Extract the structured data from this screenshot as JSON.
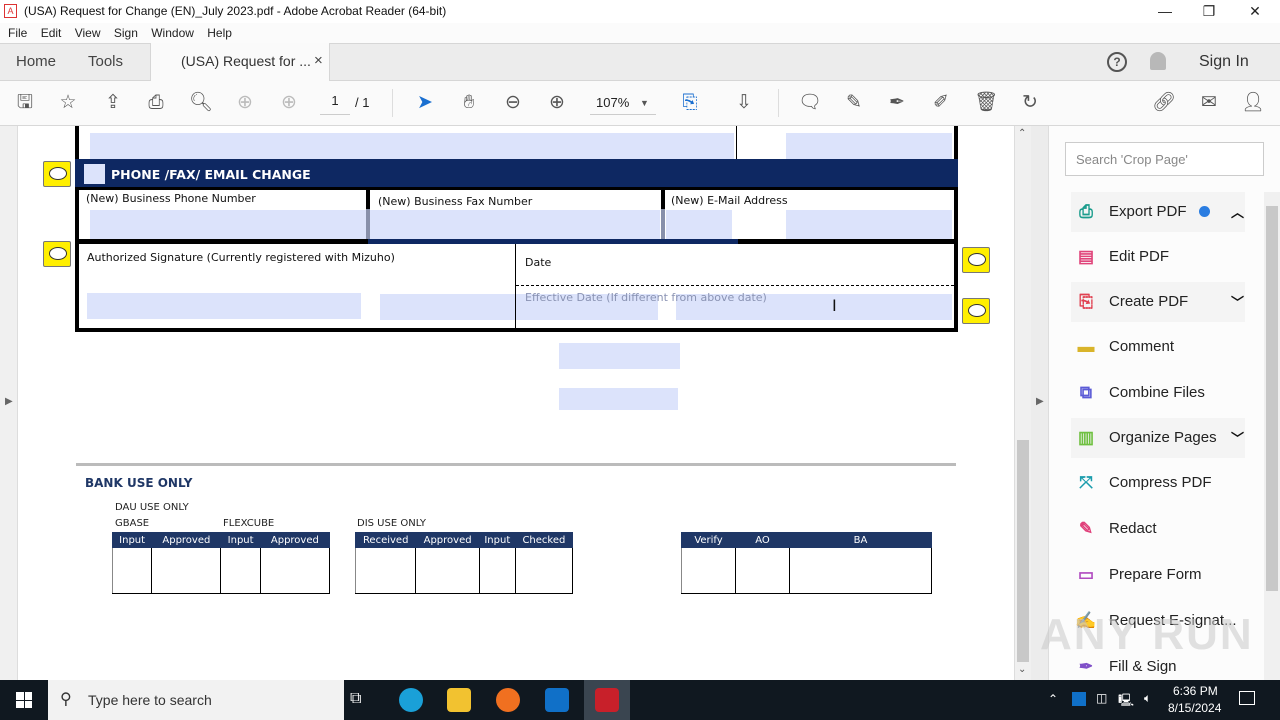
{
  "window": {
    "title": "(USA) Request for Change (EN)_July 2023.pdf - Adobe Acrobat Reader (64-bit)",
    "minimize": "—",
    "restore": "❐",
    "close": "✕"
  },
  "menu": [
    "File",
    "Edit",
    "View",
    "Sign",
    "Window",
    "Help"
  ],
  "tabs": {
    "home": "Home",
    "tools": "Tools",
    "doc": "(USA) Request for ...",
    "doc_close": "×",
    "sign_in": "Sign In"
  },
  "toolbar": {
    "page_current": "1",
    "page_total": "/ 1",
    "zoom": "107%"
  },
  "form": {
    "section_title": "PHONE /FAX/ EMAIL CHANGE",
    "phone_label": "(New) Business Phone Number",
    "fax_label": "(New) Business Fax Number",
    "email_label": "(New) E-Mail Address",
    "signature_label": "Authorized Signature (Currently registered with Mizuho)",
    "date_label": "Date",
    "effective_date_label": "Effective Date (If different from above date)"
  },
  "bank": {
    "title": "BANK USE ONLY",
    "dau": "DAU USE ONLY",
    "gbase": "GBASE",
    "flexcube": "FLEXCUBE",
    "dis": "DIS USE ONLY",
    "table1_headers": [
      "Input",
      "Approved",
      "Input",
      "Approved"
    ],
    "table2_headers": [
      "Received",
      "Approved",
      "Input",
      "Checked"
    ],
    "table3_headers": [
      "Verify",
      "AO",
      "BA"
    ]
  },
  "right_panel": {
    "search_placeholder": "Search 'Crop Page'",
    "tools": [
      {
        "label": "Export PDF",
        "icon": "export-pdf-icon",
        "color": "#1a9c8c",
        "chevron": "up"
      },
      {
        "label": "Edit PDF",
        "icon": "edit-pdf-icon",
        "color": "#e0457b"
      },
      {
        "label": "Create PDF",
        "icon": "create-pdf-icon",
        "color": "#e04050",
        "chevron": "down"
      },
      {
        "label": "Comment",
        "icon": "comment-icon",
        "color": "#d9b42a"
      },
      {
        "label": "Combine Files",
        "icon": "combine-files-icon",
        "color": "#5b5bd6"
      },
      {
        "label": "Organize Pages",
        "icon": "organize-pages-icon",
        "color": "#6fc040",
        "chevron": "down"
      },
      {
        "label": "Compress PDF",
        "icon": "compress-pdf-icon",
        "color": "#1a9cac"
      },
      {
        "label": "Redact",
        "icon": "redact-icon",
        "color": "#e0407a"
      },
      {
        "label": "Prepare Form",
        "icon": "prepare-form-icon",
        "color": "#b04ac0"
      },
      {
        "label": "Request E-signat...",
        "icon": "request-esign-icon",
        "color": "#9040b0"
      },
      {
        "label": "Fill & Sign",
        "icon": "fill-sign-icon",
        "color": "#8050c8"
      }
    ]
  },
  "taskbar": {
    "search_placeholder": "Type here to search",
    "time": "6:36 PM",
    "date": "8/15/2024"
  },
  "watermark": "ANY RUN"
}
